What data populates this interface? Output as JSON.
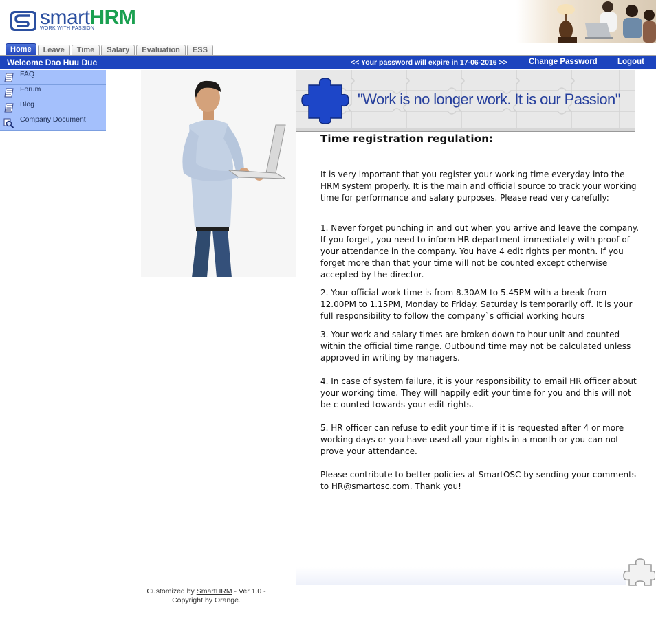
{
  "brand": {
    "word_part1": "smart",
    "word_part2": "HRM",
    "tagline": "WORK WITH PASSION",
    "blue": "#2b4fa0",
    "green": "#1aa050"
  },
  "tabs": [
    {
      "label": "Home",
      "active": true
    },
    {
      "label": "Leave",
      "active": false
    },
    {
      "label": "Time",
      "active": false
    },
    {
      "label": "Salary",
      "active": false
    },
    {
      "label": "Evaluation",
      "active": false
    },
    {
      "label": "ESS",
      "active": false
    }
  ],
  "status_bar": {
    "welcome": "Welcome Dao Huu Duc",
    "password_notice": "<<  Your password will expire in 17-06-2016  >>",
    "change_password": "Change Password",
    "logout": "Logout",
    "color": "#1c44be"
  },
  "side_menu": [
    {
      "label": "FAQ",
      "icon": "document-icon"
    },
    {
      "label": "Forum",
      "icon": "document-icon"
    },
    {
      "label": "Blog",
      "icon": "document-icon"
    },
    {
      "label": "Company Document",
      "icon": "magnifier-icon"
    }
  ],
  "banner": {
    "text": "\"Work is no longer work. It is our Passion\""
  },
  "article": {
    "title": "Time registration regulation:",
    "intro": "It is very important that you register your working time everyday into the HRM system properly. It is the main and official source to track your working time for performance and salary purposes. Please read very carefully:",
    "rule1": "1. Never forget punching in and out when you arrive and leave the company. If you forget, you need to inform HR department immediately with proof of your attendance in the company. You have 4 edit rights per month. If you forget more than that your time will not be counted except otherwise accepted by the director.",
    "rule2": "2. Your official work time is from 8.30AM to 5.45PM with a break from 12.00PM to 1.15PM, Monday to Friday. Saturday is temporarily off. It is your full responsibility to follow the company`s official working hours",
    "rule3": "3. Your work and salary times are broken down to hour unit and counted within the official time range. Outbound time may not be calculated unless approved in writing by managers.",
    "rule4": "4. In case of system failure, it is your responsibility to email HR officer about your working time. They will happily edit your time for you and this will not be c ounted towards your edit rights.",
    "rule5": "5. HR officer can refuse to edit your time if it is requested after 4 or more working days or you have used all your rights in a month or you can not prove your attendance.",
    "closing": "Please contribute to better policies at SmartOSC by sending your comments to HR@smartosc.com. Thank you!"
  },
  "footer": {
    "prefix": "Customized by ",
    "link": "SmartHRM",
    "suffix": " - Ver 1.0 -",
    "line2": "Copyright by Orange."
  }
}
